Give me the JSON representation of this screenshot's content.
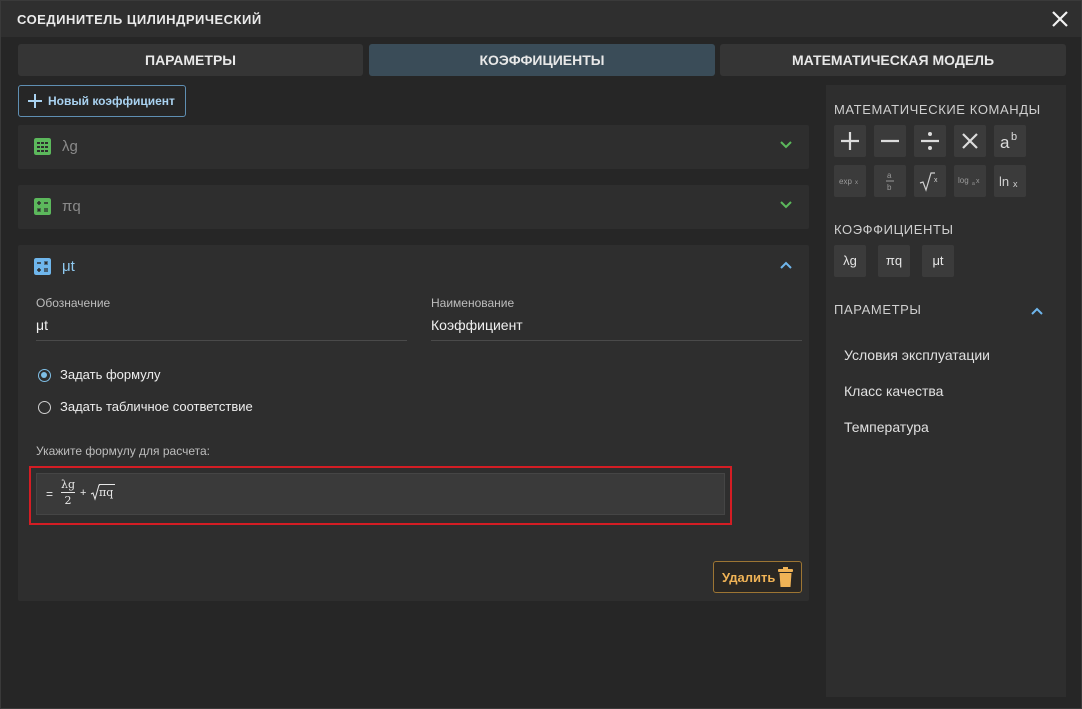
{
  "window": {
    "title": "СОЕДИНИТЕЛЬ ЦИЛИНДРИЧЕСКИЙ",
    "close_icon": "close-icon"
  },
  "tabs": [
    {
      "label": "ПАРАМЕТРЫ",
      "active": false
    },
    {
      "label": "КОЭФФИЦИЕНТЫ",
      "active": true
    },
    {
      "label": "МАТЕМАТИЧЕСКАЯ МОДЕЛЬ",
      "active": false
    }
  ],
  "toolbar": {
    "new_coef_label": "Новый коэффициент"
  },
  "coefficients": [
    {
      "label": "λg",
      "expanded": false,
      "icon": "table-icon",
      "icon_color": "#5cb85c"
    },
    {
      "label": "πq",
      "expanded": false,
      "icon": "calculator-icon",
      "icon_color": "#5cb85c"
    },
    {
      "label": "μt",
      "expanded": true,
      "icon": "calculator-icon",
      "icon_color": "#6fb6ec"
    }
  ],
  "editor": {
    "designation_label": "Обозначение",
    "designation_value": "μt",
    "name_label": "Наименование",
    "name_value": "Коэффициент",
    "radio_formula": "Задать формулу",
    "radio_table": "Задать табличное соответствие",
    "selected": "formula",
    "formula_prompt": "Укажите формулу для расчета:",
    "formula": {
      "eq": "=",
      "numerator": "λg",
      "denominator": "2",
      "plus": "+",
      "sqrt_arg": "πq"
    },
    "delete_label": "Удалить"
  },
  "side": {
    "math_title": "МАТЕМАТИЧЕСКИЕ КОМАНДЫ",
    "math_commands": [
      {
        "name": "plus",
        "glyph": "+"
      },
      {
        "name": "minus",
        "glyph": "−"
      },
      {
        "name": "divide",
        "glyph": "÷"
      },
      {
        "name": "multiply",
        "glyph": "×"
      },
      {
        "name": "power",
        "glyph": "aᵇ"
      },
      {
        "name": "exp",
        "glyph": "expₓ"
      },
      {
        "name": "fraction",
        "glyph": "a/b"
      },
      {
        "name": "sqrt",
        "glyph": "√ₓ"
      },
      {
        "name": "log",
        "glyph": "logₐx"
      },
      {
        "name": "ln",
        "glyph": "lnₓ"
      }
    ],
    "coef_title": "КОЭФФИЦИЕНТЫ",
    "coef_buttons": [
      "λg",
      "πq",
      "μt"
    ],
    "params_title": "ПАРАМЕТРЫ",
    "params": [
      "Условия эксплуатации",
      "Класс качества",
      "Температура"
    ]
  },
  "colors": {
    "accent_blue": "#6fb6ec",
    "accent_green": "#5cb85c",
    "highlight_red": "#d41d24",
    "delete_orange": "#f0b356"
  }
}
